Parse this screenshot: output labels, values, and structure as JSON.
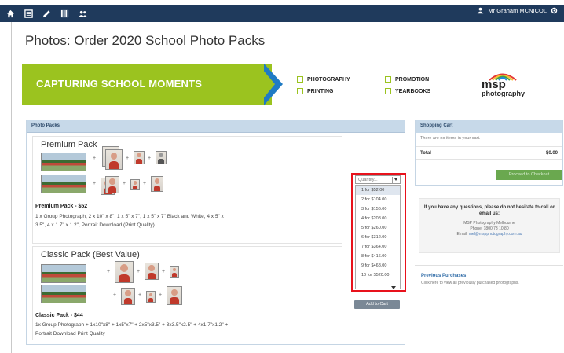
{
  "topbar": {
    "user_name": "Mr Graham MCNICOL",
    "icons": [
      "home-icon",
      "list-icon",
      "pencil-icon",
      "grid-icon",
      "users-icon"
    ]
  },
  "page": {
    "title": "Photos: Order 2020 School Photo Packs"
  },
  "banner": {
    "tagline": "CAPTURING SCHOOL MOMENTS",
    "services": [
      "PHOTOGRAPHY",
      "PRINTING",
      "PROMOTION",
      "YEARBOOKS"
    ],
    "logo_main": "msp",
    "logo_sub": "photography",
    "colors": {
      "green": "#9bc31f",
      "blue": "#1f7bc4"
    }
  },
  "photo_packs": {
    "header": "Photo Packs",
    "premium": {
      "title": "Premium Pack",
      "price": "Premium Pack - $52",
      "desc_line1": "1 x Group Photograph, 2 x 10\" x 8\", 1 x 5\" x 7\", 1 x 5\" x 7\" Black and White, 4 x 5\" x",
      "desc_line2": "3.5\", 4 x 1.7\" x 1.2\", Portrait Download (Print Quality)"
    },
    "classic": {
      "title": "Classic Pack (Best Value)",
      "price": "Classic Pack - $44",
      "desc_line1": "1x Group Photograph + 1x10\"x8\" + 1x5\"x7\" + 2x5\"x3.5\" + 3x3.5\"x2.5\" + 4x1.7\"x1.2\" +",
      "desc_line2": "Portrait Download Print Quality"
    },
    "quantity": {
      "placeholder": "Quantity...",
      "options": [
        "1 for $52.00",
        "2 for $104.00",
        "3 for $156.00",
        "4 for $208.00",
        "5 for $260.00",
        "6 for $312.00",
        "7 for $364.00",
        "8 for $416.00",
        "9 for $468.00",
        "10 for $520.00"
      ],
      "selected_index": 0
    },
    "add_to_cart": "Add to Cart"
  },
  "cart": {
    "header": "Shopping Cart",
    "empty_text": "There are no items in your cart.",
    "total_label": "Total",
    "total_value": "$0.00",
    "checkout": "Proceed to Checkout"
  },
  "help": {
    "question": "If you have any questions, please do not hesitate to call or email us:",
    "company": "MSP Photography Melbourne",
    "phone": "Phone: 1800 73 10 80",
    "email_label": "Email:",
    "email": "mel@mspphotography.com.au"
  },
  "previous": {
    "title": "Previous Purchases",
    "desc": "Click here to view all previously purchased photographs."
  }
}
